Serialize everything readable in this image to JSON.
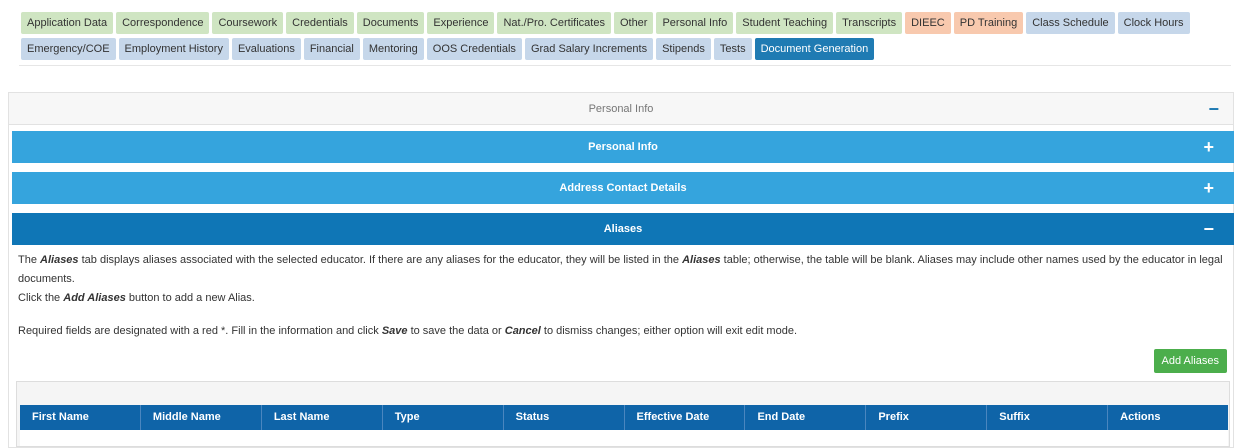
{
  "tabs": {
    "row1": [
      {
        "label": "Application Data",
        "color": "green"
      },
      {
        "label": "Correspondence",
        "color": "green"
      },
      {
        "label": "Coursework",
        "color": "green"
      },
      {
        "label": "Credentials",
        "color": "green"
      },
      {
        "label": "Documents",
        "color": "green"
      },
      {
        "label": "Experience",
        "color": "green"
      },
      {
        "label": "Nat./Pro. Certificates",
        "color": "green"
      },
      {
        "label": "Other",
        "color": "green"
      },
      {
        "label": "Personal Info",
        "color": "green"
      },
      {
        "label": "Student Teaching",
        "color": "green"
      },
      {
        "label": "Transcripts",
        "color": "green"
      },
      {
        "label": "DIEEC",
        "color": "orange"
      },
      {
        "label": "PD Training",
        "color": "orange"
      },
      {
        "label": "Class Schedule",
        "color": "blue"
      },
      {
        "label": "Clock Hours",
        "color": "blue"
      }
    ],
    "row2": [
      {
        "label": "Emergency/COE",
        "color": "blue"
      },
      {
        "label": "Employment History",
        "color": "blue"
      },
      {
        "label": "Evaluations",
        "color": "blue"
      },
      {
        "label": "Financial",
        "color": "blue"
      },
      {
        "label": "Mentoring",
        "color": "blue"
      },
      {
        "label": "OOS Credentials",
        "color": "blue"
      },
      {
        "label": "Grad Salary Increments",
        "color": "blue"
      },
      {
        "label": "Stipends",
        "color": "blue"
      },
      {
        "label": "Tests",
        "color": "blue"
      },
      {
        "label": "Document Generation",
        "color": "active"
      }
    ]
  },
  "outer_panel": {
    "title": "Personal Info",
    "toggle": "−"
  },
  "sections": {
    "personal_info": {
      "title": "Personal Info",
      "toggle": "+"
    },
    "address": {
      "title": "Address Contact Details",
      "toggle": "+"
    },
    "aliases": {
      "title": "Aliases",
      "toggle": "−"
    }
  },
  "aliases_content": {
    "p1_a": "The ",
    "p1_b": "Aliases",
    "p1_c": " tab displays aliases associated with the selected educator. If there are any aliases for the educator, they will be listed in the ",
    "p1_d": "Aliases",
    "p1_e": " table; otherwise, the table will be blank. Aliases may include other names used by the educator in legal documents.",
    "p2_a": "Click the ",
    "p2_b": "Add Aliases",
    "p2_c": " button to add a new Alias.",
    "p3_a": "Required fields are designated with a red *. Fill in the information and click ",
    "p3_b": "Save",
    "p3_c": " to save the data or ",
    "p3_d": "Cancel",
    "p3_e": " to dismiss changes; either option will exit edit mode.",
    "add_button": "Add Aliases"
  },
  "table": {
    "columns": [
      "First Name",
      "Middle Name",
      "Last Name",
      "Type",
      "Status",
      "Effective Date",
      "End Date",
      "Prefix",
      "Suffix",
      "Actions"
    ]
  },
  "colors": {
    "tab_green": "#cfe5c2",
    "tab_orange": "#f8c9ae",
    "tab_blue": "#c6d7ea",
    "tab_active": "#1f7bb3",
    "bar_light": "#35a4dd",
    "bar_dark": "#0f76b6",
    "table_header": "#0f64a8",
    "add_button": "#4cae4c"
  }
}
